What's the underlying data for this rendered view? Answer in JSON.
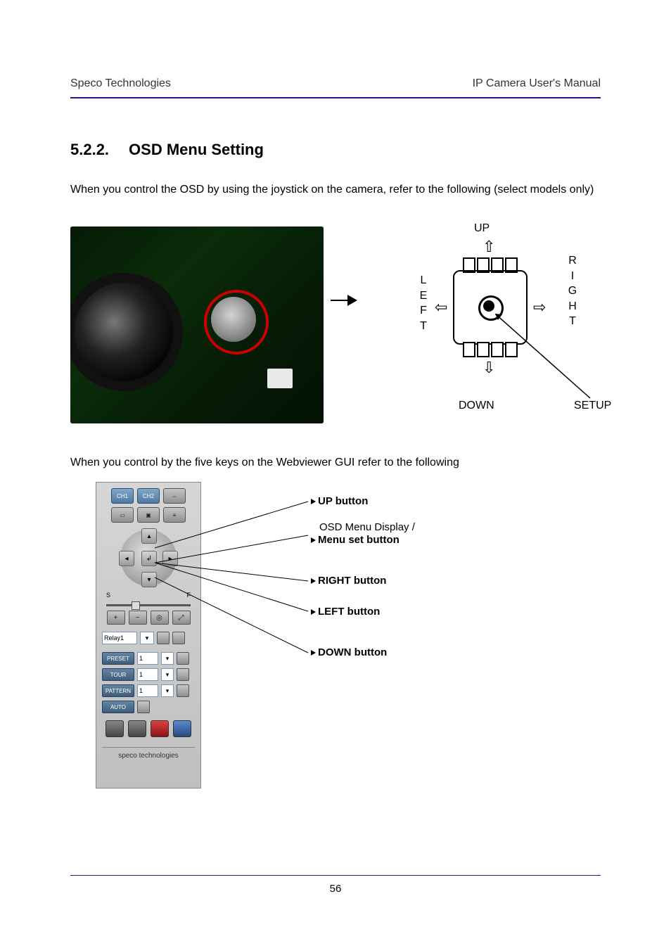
{
  "header": {
    "left": "Speco Technologies",
    "right": "IP Camera User's Manual"
  },
  "section": {
    "number": "5.2.2.",
    "title": "OSD Menu Setting"
  },
  "paragraph1": "When you control the OSD by using the joystick on the camera, refer to the following (select models only)",
  "paragraph2": "When you control by the five keys on the Webviewer GUI refer to the following",
  "joystick": {
    "up": "UP",
    "down": "DOWN",
    "left_chars": [
      "L",
      "E",
      "F",
      "T"
    ],
    "right_chars": [
      "R",
      "I",
      "G",
      "H",
      "T"
    ],
    "setup": "SETUP"
  },
  "callouts": {
    "up": "UP button",
    "menu1": "OSD Menu Display /",
    "menu2": "Menu set button",
    "right": "RIGHT button",
    "left": "LEFT button",
    "down": "DOWN button"
  },
  "panel": {
    "row1": [
      "CH1",
      "CH2",
      "⇔"
    ],
    "row2_icon_names": [
      "window-icon",
      "fullscreen-icon",
      "list-icon"
    ],
    "slider_labels": {
      "left": "S",
      "right": "F"
    },
    "icon_row_names": [
      "plus-icon",
      "minus-icon",
      "target-icon",
      "expand-icon"
    ],
    "relay_label": "Relay1",
    "relay_dropdown": "▾",
    "rows": [
      {
        "label": "PRESET",
        "val": "1"
      },
      {
        "label": "TOUR",
        "val": "1"
      },
      {
        "label": "PATTERN",
        "val": "1"
      },
      {
        "label": "AUTO",
        "val": ""
      }
    ],
    "bottom_icon_names": [
      "snapshot-icon",
      "camera-icon",
      "record-icon",
      "stop-icon"
    ],
    "brand": "speco technologies"
  },
  "page_number": "56"
}
